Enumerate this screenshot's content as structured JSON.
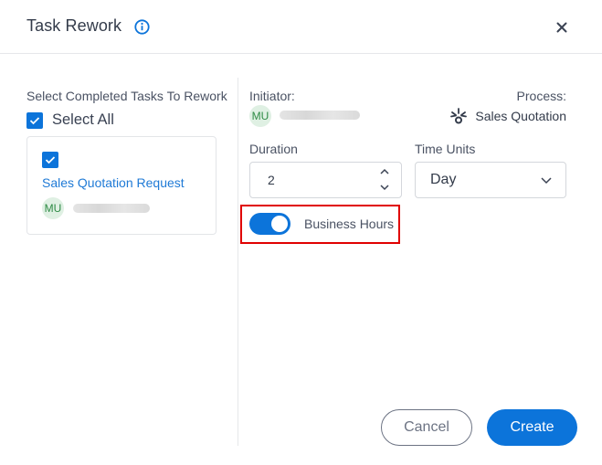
{
  "dialog": {
    "title": "Task Rework",
    "info_icon": "info-circle-icon",
    "close_icon": "close-x-icon"
  },
  "left": {
    "section_label": "Select Completed Tasks To Rework",
    "select_all_label": "Select All",
    "select_all_checked": true,
    "tasks": [
      {
        "name": "Sales Quotation Request",
        "checked": true,
        "avatar_initials": "MU",
        "user_name_redacted": true
      }
    ]
  },
  "right": {
    "initiator_label": "Initiator:",
    "initiator_initials": "MU",
    "process_label": "Process:",
    "process_name": "Sales Quotation",
    "process_icon": "process-node-icon",
    "duration_label": "Duration",
    "duration_value": "2",
    "time_units_label": "Time Units",
    "time_units_value": "Day",
    "business_hours_label": "Business Hours",
    "business_hours_on": true
  },
  "footer": {
    "cancel_label": "Cancel",
    "create_label": "Create"
  },
  "colors": {
    "accent": "#0c74da",
    "highlight": "#e00000",
    "avatar_bg": "#dff0e3",
    "avatar_text": "#2e8b45"
  }
}
